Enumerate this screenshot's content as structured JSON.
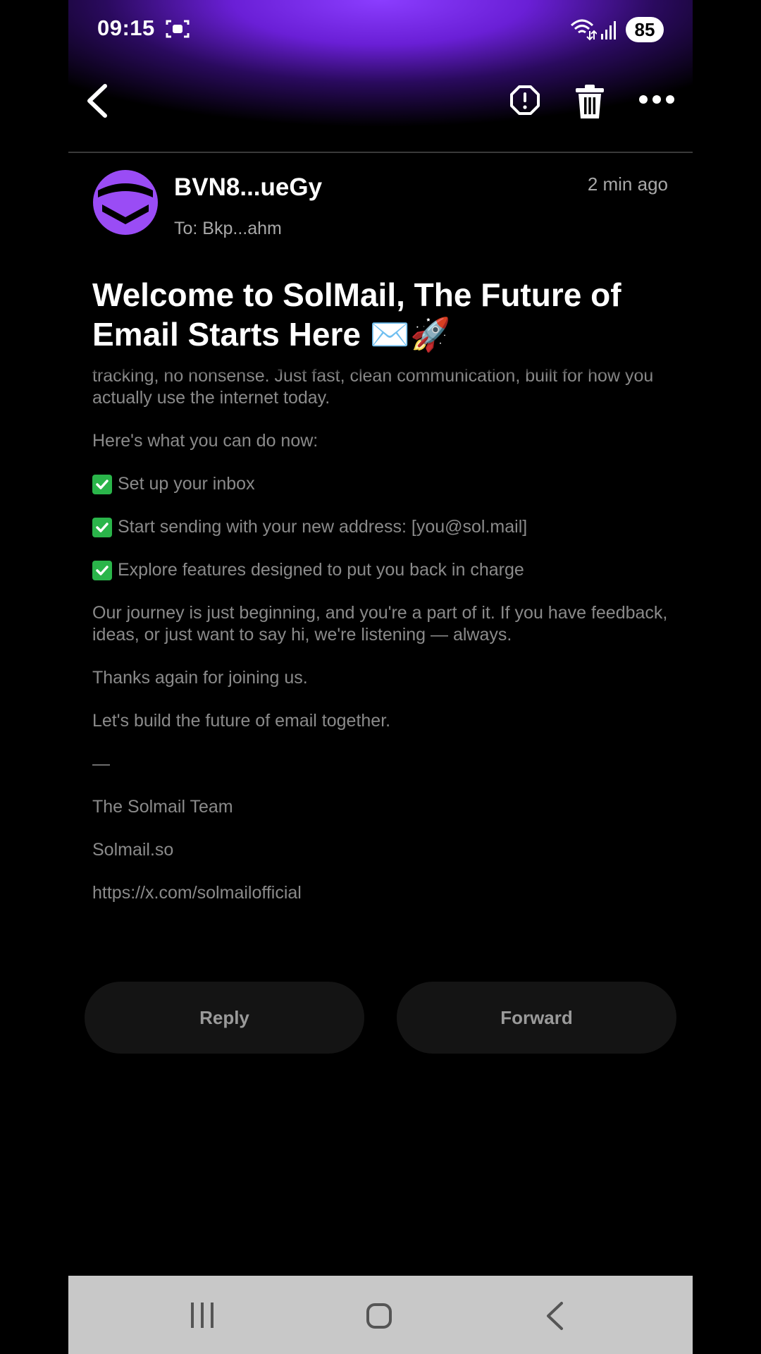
{
  "status_bar": {
    "time": "09:15",
    "battery": "85",
    "icons": [
      "screen-record-icon",
      "wifi-icon",
      "signal-icon",
      "battery-icon"
    ]
  },
  "toolbar": {
    "icons": [
      "back-arrow-icon",
      "report-spam-icon",
      "trash-icon",
      "more-icon"
    ]
  },
  "email": {
    "sender": "BVN8...ueGy",
    "recipient": "To: Bkp...ahm",
    "time": "2 min ago",
    "subject": "Welcome to SolMail, The Future of Email Starts Here ✉️🚀",
    "body": {
      "partial_line": "tracking, no nonsense. Just fast, clean communication, built for how you actually use the internet today.",
      "intro": "Here's what you can do now:",
      "checklist": [
        "Set up your inbox",
        "Start sending with your new address: [you@sol.mail]",
        "Explore features designed to put you back in charge"
      ],
      "journey": "Our journey is just beginning, and you're a part of it. If you have feedback, ideas, or just want to say hi, we're listening — always.",
      "thanks": "Thanks again for joining us.",
      "build": "Let's build the future of email together.",
      "dash": "—",
      "signature": "The Solmail Team",
      "site": "Solmail.so",
      "twitter": "https://x.com/solmailofficial"
    }
  },
  "actions": {
    "reply": "Reply",
    "forward": "Forward"
  },
  "colors": {
    "accent": "#8b3dff",
    "check": "#2ab54a",
    "body_text": "#8a8a8a"
  }
}
